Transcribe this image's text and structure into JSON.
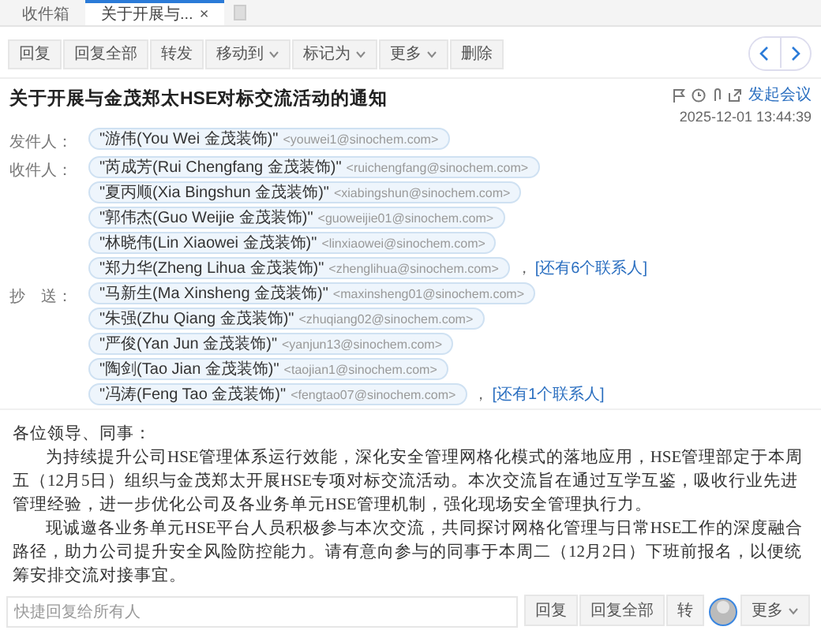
{
  "tabs": [
    {
      "label": "收件箱",
      "selected": false
    },
    {
      "label": "关于开展与...",
      "selected": true,
      "close": "×"
    }
  ],
  "toolbar": [
    {
      "label": "回复",
      "dropdown": false
    },
    {
      "label": "回复全部",
      "dropdown": false
    },
    {
      "label": "转发",
      "dropdown": false
    },
    {
      "label": "移动到",
      "dropdown": true
    },
    {
      "label": "标记为",
      "dropdown": true
    },
    {
      "label": "更多",
      "dropdown": true
    },
    {
      "label": "删除",
      "dropdown": false
    }
  ],
  "message": {
    "subject": "关于开展与金茂郑太HSE对标交流活动的通知",
    "meeting_link": "发起会议",
    "date": "2025-12-01 13:44:39",
    "fields": [
      {
        "label": "发件人：",
        "contacts": [
          {
            "name": "\"游伟(You Wei 金茂装饰)\"",
            "email": "<youwei1@sinochem.com>"
          }
        ]
      },
      {
        "label": "收件人：",
        "contacts": [
          {
            "name": "\"芮成芳(Rui Chengfang 金茂装饰)\"",
            "email": "<ruichengfang@sinochem.com>"
          },
          {
            "name": "\"夏丙顺(Xia Bingshun 金茂装饰)\"",
            "email": "<xiabingshun@sinochem.com>"
          },
          {
            "name": "\"郭伟杰(Guo Weijie 金茂装饰)\"",
            "email": "<guoweijie01@sinochem.com>"
          },
          {
            "name": "\"林晓伟(Lin Xiaowei 金茂装饰)\"",
            "email": "<linxiaowei@sinochem.com>"
          },
          {
            "name": "\"郑力华(Zheng Lihua 金茂装饰)\"",
            "email": "<zhenglihua@sinochem.com>"
          }
        ],
        "separator": "，",
        "more": "[还有6个联系人]"
      },
      {
        "label": "抄　送：",
        "contacts": [
          {
            "name": "\"马新生(Ma Xinsheng 金茂装饰)\"",
            "email": "<maxinsheng01@sinochem.com>"
          },
          {
            "name": "\"朱强(Zhu Qiang 金茂装饰)\"",
            "email": "<zhuqiang02@sinochem.com>"
          },
          {
            "name": "\"严俊(Yan Jun 金茂装饰)\"",
            "email": "<yanjun13@sinochem.com>"
          },
          {
            "name": "\"陶剑(Tao Jian 金茂装饰)\"",
            "email": "<taojian1@sinochem.com>"
          },
          {
            "name": "\"冯涛(Feng Tao 金茂装饰)\"",
            "email": "<fengtao07@sinochem.com>"
          }
        ],
        "separator": "，",
        "more": "[还有1个联系人]"
      }
    ]
  },
  "body": {
    "greeting": "各位领导、同事：",
    "paragraphs": [
      "为持续提升公司HSE管理体系运行效能，深化安全管理网格化模式的落地应用，HSE管理部定于本周五（12月5日）组织与金茂郑太开展HSE专项对标交流活动。本次交流旨在通过互学互鉴，吸收行业先进管理经验，进一步优化公司及各业务单元HSE管理机制，强化现场安全管理执行力。",
      "现诚邀各业务单元HSE平台人员积极参与本次交流，共同探讨网格化管理与日常HSE工作的深度融合路径，助力公司提升安全风险防控能力。请有意向参与的同事于本周二（12月2日）下班前报名，以便统筹安排交流对接事宜。"
    ]
  },
  "quick_reply": {
    "placeholder": "快捷回复给所有人",
    "buttons": [
      {
        "label": "回复",
        "dropdown": false
      },
      {
        "label": "回复全部",
        "dropdown": false
      },
      {
        "label": "转",
        "dropdown": false
      },
      {
        "label": "更多",
        "dropdown": true
      }
    ]
  }
}
